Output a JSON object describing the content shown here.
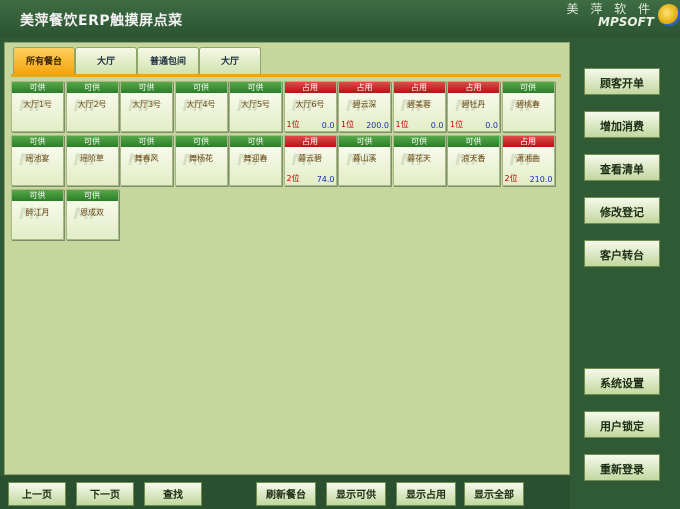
{
  "app": {
    "title": "美萍餐饮ERP触摸屏点菜"
  },
  "brand": {
    "name_cn": "美 萍 软 件",
    "name_en": "MPSOFT"
  },
  "tabs": [
    {
      "label": "所有餐台",
      "active": true
    },
    {
      "label": "大厅",
      "active": false
    },
    {
      "label": "普通包间",
      "active": false
    },
    {
      "label": "大厅",
      "active": false
    }
  ],
  "status_labels": {
    "free": "可供",
    "used": "占用"
  },
  "watermark": "MP",
  "colors": {
    "free": "#2b7d28",
    "used": "#b41414",
    "active_tab": "#f2a10a",
    "panel": "#c6d69c"
  },
  "tables": [
    {
      "name": "大厅1号",
      "status": "free"
    },
    {
      "name": "大厅2号",
      "status": "free"
    },
    {
      "name": "大厅3号",
      "status": "free"
    },
    {
      "name": "大厅4号",
      "status": "free"
    },
    {
      "name": "大厅5号",
      "status": "free"
    },
    {
      "name": "大厅6号",
      "status": "used",
      "seats": "1位",
      "amount": "0.0"
    },
    {
      "name": "碧云深",
      "status": "used",
      "seats": "1位",
      "amount": "200.0"
    },
    {
      "name": "碧美蓉",
      "status": "used",
      "seats": "1位",
      "amount": "0.0"
    },
    {
      "name": "碧牡丹",
      "status": "used",
      "seats": "1位",
      "amount": "0.0"
    },
    {
      "name": "碧桃春",
      "status": "free"
    },
    {
      "name": "瑶池宴",
      "status": "free"
    },
    {
      "name": "瑶阶草",
      "status": "free"
    },
    {
      "name": "舞春风",
      "status": "free"
    },
    {
      "name": "舞杨花",
      "status": "free"
    },
    {
      "name": "舞迎春",
      "status": "free"
    },
    {
      "name": "暮云碧",
      "status": "used",
      "seats": "2位",
      "amount": "74.0"
    },
    {
      "name": "暮山溪",
      "status": "free"
    },
    {
      "name": "暮花天",
      "status": "free"
    },
    {
      "name": "浪天香",
      "status": "free"
    },
    {
      "name": "潇湘曲",
      "status": "used",
      "seats": "2位",
      "amount": "210.0"
    },
    {
      "name": "醉江月",
      "status": "free"
    },
    {
      "name": "恩成双",
      "status": "free"
    }
  ],
  "sidebar": {
    "open_table": "顾客开单",
    "add_order": "增加消费",
    "view_list": "查看清单",
    "edit_register": "修改登记",
    "transfer_table": "客户转台",
    "system_settings": "系统设置",
    "user_lock": "用户锁定",
    "relogin": "重新登录"
  },
  "bottom": {
    "prev_page": "上一页",
    "next_page": "下一页",
    "find": "查找",
    "refresh": "刷新餐台",
    "show_free": "显示可供",
    "show_used": "显示占用",
    "show_all": "显示全部"
  }
}
